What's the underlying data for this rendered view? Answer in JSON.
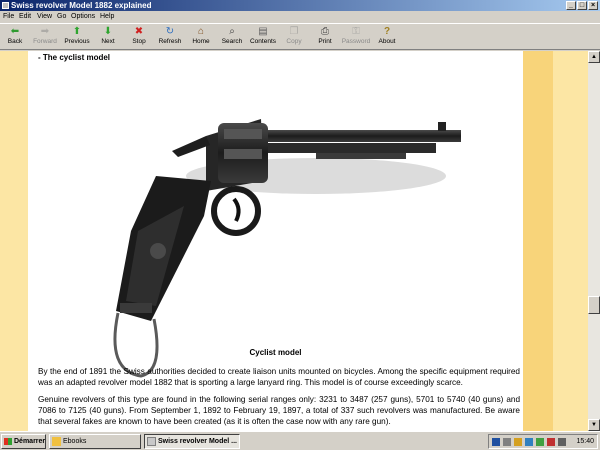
{
  "window": {
    "title": "Swiss revolver Model 1882 explained",
    "controls": {
      "minimize": "_",
      "maximize": "□",
      "close": "×"
    }
  },
  "menu": [
    "File",
    "Edit",
    "View",
    "Go",
    "Options",
    "Help"
  ],
  "toolbar": [
    {
      "label": "Back",
      "icon": "back-arrow-icon",
      "glyph": "⬅",
      "color": "#2f9a2f",
      "enabled": true
    },
    {
      "label": "Forward",
      "icon": "forward-arrow-icon",
      "glyph": "➡",
      "color": "#808080",
      "enabled": false
    },
    {
      "label": "Previous",
      "icon": "up-arrow-icon",
      "glyph": "⬆",
      "color": "#2fa52f",
      "enabled": true
    },
    {
      "label": "Next",
      "icon": "down-arrow-icon",
      "glyph": "⬇",
      "color": "#2fa52f",
      "enabled": true
    },
    {
      "label": "Stop",
      "icon": "stop-icon",
      "glyph": "✖",
      "color": "#d02020",
      "enabled": true
    },
    {
      "label": "Refresh",
      "icon": "refresh-icon",
      "glyph": "↻",
      "color": "#3070c0",
      "enabled": true
    },
    {
      "label": "Home",
      "icon": "home-icon",
      "glyph": "⌂",
      "color": "#805020",
      "enabled": true
    },
    {
      "label": "Search",
      "icon": "search-icon",
      "glyph": "⌕",
      "color": "#404040",
      "enabled": true
    },
    {
      "label": "Contents",
      "icon": "contents-icon",
      "glyph": "▤",
      "color": "#606060",
      "enabled": true
    },
    {
      "label": "Copy",
      "icon": "copy-icon",
      "glyph": "❐",
      "color": "#808080",
      "enabled": false
    },
    {
      "label": "Print",
      "icon": "print-icon",
      "glyph": "⎙",
      "color": "#404040",
      "enabled": true
    },
    {
      "label": "Password",
      "icon": "key-icon",
      "glyph": "⚿",
      "color": "#808080",
      "enabled": false
    },
    {
      "label": "About",
      "icon": "about-icon",
      "glyph": "?",
      "color": "#a08020",
      "enabled": true
    }
  ],
  "content": {
    "section_heading": "- The cyclist model",
    "caption": "Cyclist model",
    "paragraphs": [
      "By the end of 1891 the Swiss authorities decided to create liaison units mounted on bicycles. Among the specific equipment required was an adapted revolver model 1882 that is sporting a large lanyard ring. This model is of course exceedingly scarce.",
      "Genuine revolvers of this type are found in the following serial ranges only: 3231 to 3487 (257 guns), 5701 to 5740 (40 guns) and 7086 to 7125 (40 guns). From September 1, 1892 to February 19, 1897, a total of 337 such revolvers was manufactured. Be aware that several fakes are known to have been created (as it is often the case now with any rare gun)."
    ]
  },
  "taskbar": {
    "start_label": "Démarrer",
    "tasks": [
      "Ebooks",
      "Swiss revolver Model ..."
    ],
    "clock": "15:40"
  },
  "colors": {
    "left_strip": "#fce6a4",
    "right_strip_dark": "#f8d47a",
    "right_strip_light": "#fce6a4"
  }
}
